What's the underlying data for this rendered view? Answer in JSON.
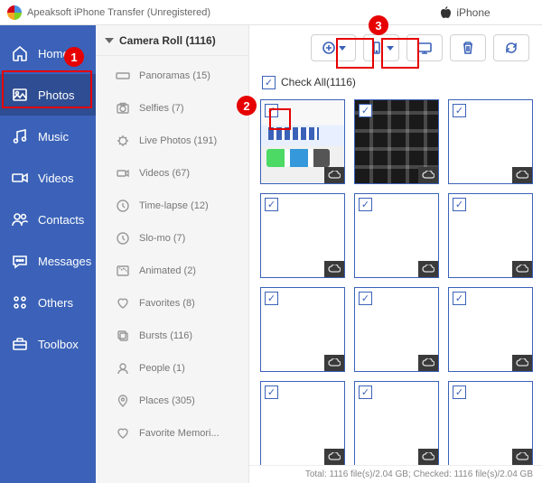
{
  "app": {
    "title": "Apeaksoft iPhone Transfer (Unregistered)"
  },
  "device": {
    "name": "iPhone"
  },
  "sidebar": {
    "items": [
      {
        "label": "Home"
      },
      {
        "label": "Photos"
      },
      {
        "label": "Music"
      },
      {
        "label": "Videos"
      },
      {
        "label": "Contacts"
      },
      {
        "label": "Messages"
      },
      {
        "label": "Others"
      },
      {
        "label": "Toolbox"
      }
    ]
  },
  "album": {
    "header": "Camera Roll (1116)",
    "items": [
      {
        "label": "Panoramas (15)"
      },
      {
        "label": "Selfies (7)"
      },
      {
        "label": "Live Photos (191)"
      },
      {
        "label": "Videos (67)"
      },
      {
        "label": "Time-lapse (12)"
      },
      {
        "label": "Slo-mo (7)"
      },
      {
        "label": "Animated (2)"
      },
      {
        "label": "Favorites (8)"
      },
      {
        "label": "Bursts (116)"
      },
      {
        "label": "People (1)"
      },
      {
        "label": "Places (305)"
      },
      {
        "label": "Favorite Memori..."
      }
    ]
  },
  "checkall": {
    "label": "Check All(1116)"
  },
  "status": {
    "text": "Total: 1116 file(s)/2.04 GB; Checked: 1116 file(s)/2.04 GB"
  },
  "annotations": {
    "n1": "1",
    "n2": "2",
    "n3": "3"
  }
}
